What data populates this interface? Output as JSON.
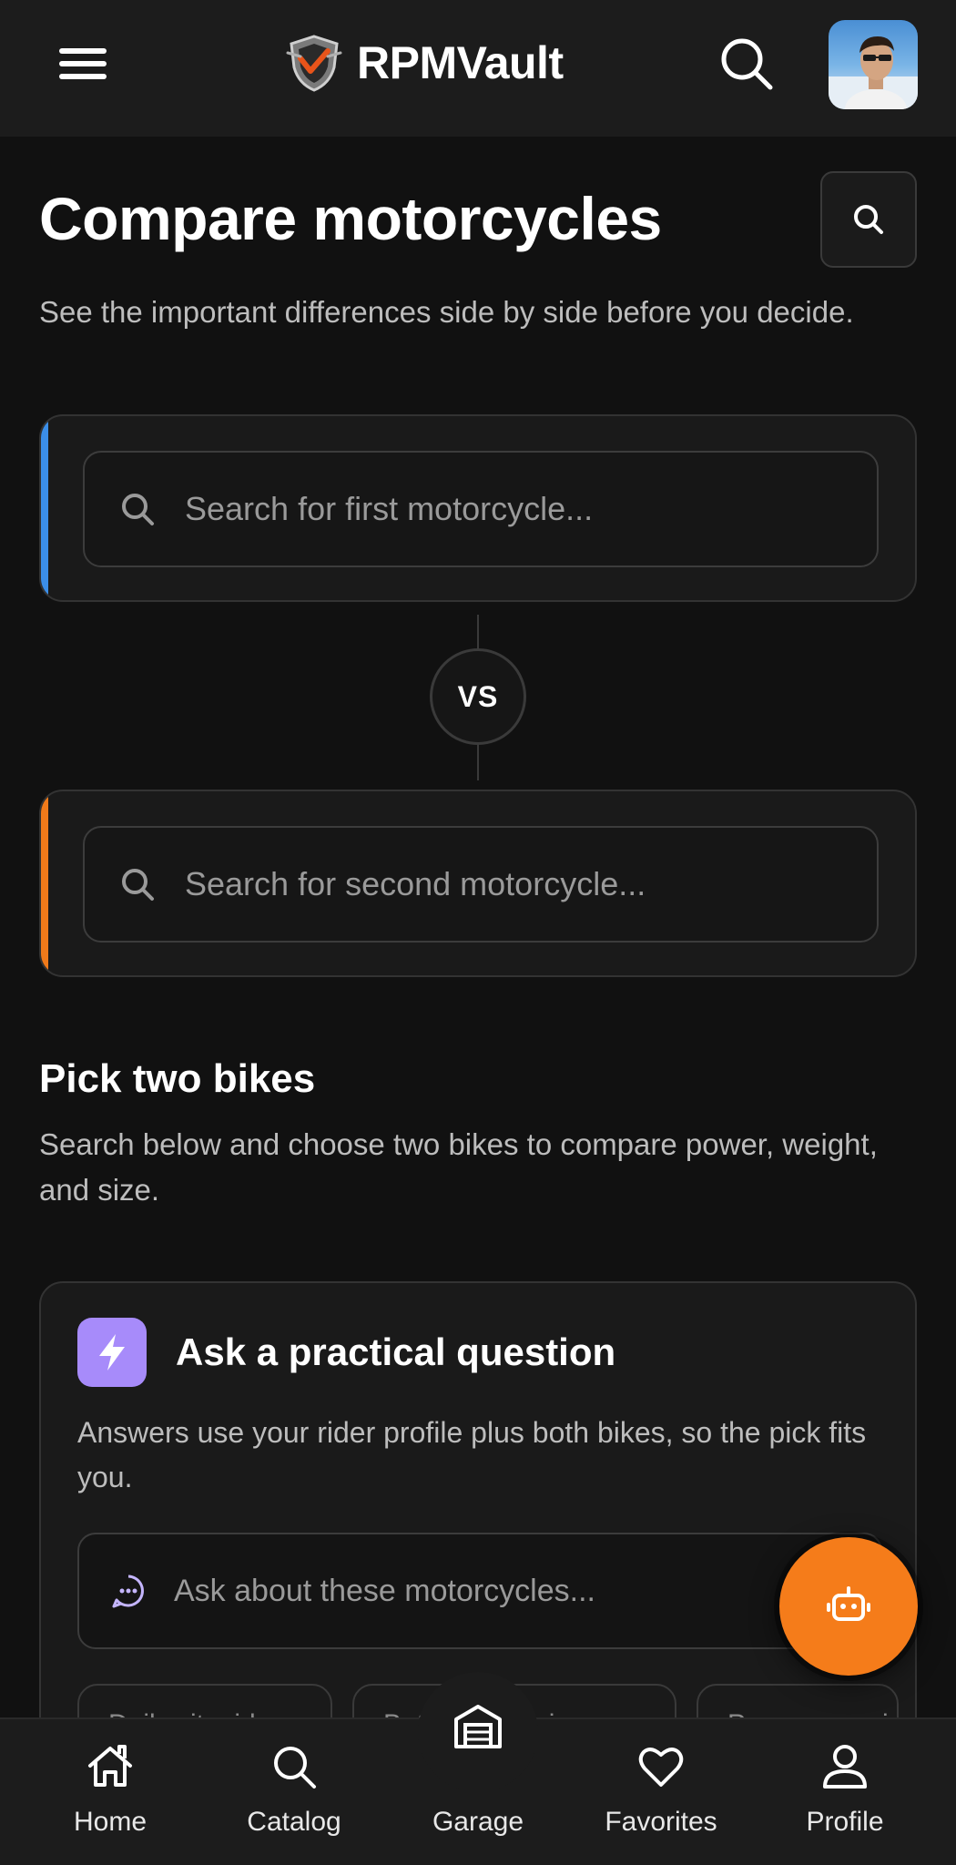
{
  "header": {
    "brand": "RPMVault",
    "menu_icon": "hamburger-menu-icon",
    "search_icon": "search-icon",
    "avatar_alt": "user-avatar"
  },
  "page": {
    "title": "Compare motorcycles",
    "subtitle": "See the important differences side by side before you decide."
  },
  "compare": {
    "first_placeholder": "Search for first motorcycle...",
    "second_placeholder": "Search for second motorcycle...",
    "vs_label": "VS",
    "first_accent": "#3b8ee8",
    "second_accent": "#f07a1a"
  },
  "pick": {
    "title": "Pick two bikes",
    "description": "Search below and choose two bikes to compare power, weight, and size."
  },
  "ask": {
    "title": "Ask a practical question",
    "description": "Answers use your rider profile plus both bikes, so the pick fits you.",
    "placeholder": "Ask about these motorcycles...",
    "icon_color": "#a78bfa",
    "chips": [
      "Daily city rides",
      "Better for beginners",
      "Power vs weight"
    ]
  },
  "fab": {
    "icon": "robot-assistant-icon",
    "color": "#f57c1a"
  },
  "nav": {
    "items": [
      {
        "label": "Home",
        "icon": "home-icon"
      },
      {
        "label": "Catalog",
        "icon": "search-icon"
      },
      {
        "label": "Garage",
        "icon": "garage-icon"
      },
      {
        "label": "Favorites",
        "icon": "heart-icon"
      },
      {
        "label": "Profile",
        "icon": "user-icon"
      }
    ]
  }
}
